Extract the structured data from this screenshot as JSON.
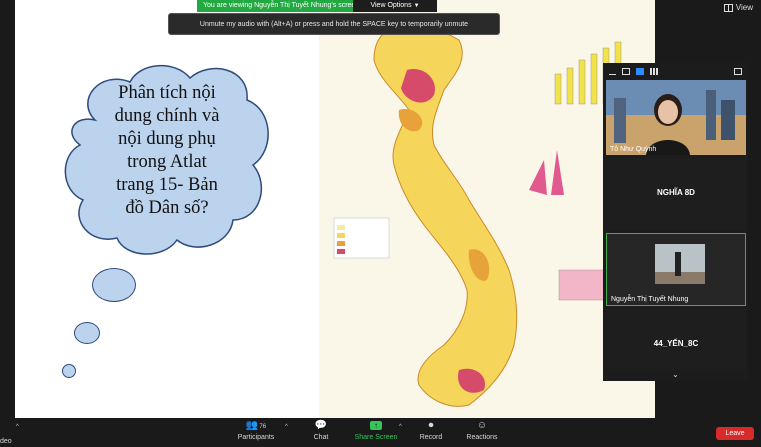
{
  "banner": {
    "sharing_text": "You are viewing Nguyễn Thị Tuyết Nhung's screen",
    "view_options_label": "View Options"
  },
  "tooltip": {
    "unmute_text": "Unmute my audio with (Alt+A) or press and hold the SPACE key to temporarily unmute"
  },
  "view_button": {
    "label": "View"
  },
  "slide": {
    "question_lines": [
      "Phân tích nội",
      "dung chính và",
      "nội dung phụ",
      "trong Atlat",
      "trang 15- Bản",
      "đồ Dân số?"
    ]
  },
  "participants": [
    {
      "name": "Tô Như Quỳnh",
      "video": true
    },
    {
      "name": "NGHĨA 8D",
      "video": false
    },
    {
      "name": "Nguyễn Thị Tuyết Nhung",
      "video": true
    },
    {
      "name": "44_YẾN_8C",
      "video": false
    }
  ],
  "toolbar": {
    "left_label": "deo",
    "participants_count": "76",
    "participants_label": "Participants",
    "chat_label": "Chat",
    "share_label": "Share Screen",
    "record_label": "Record",
    "reactions_label": "Reactions",
    "leave_label": "Leave"
  },
  "colors": {
    "share_green": "#23a942",
    "leave_red": "#d92a2a",
    "cloud_fill": "#bcd3ee",
    "cloud_stroke": "#2e4b7d"
  }
}
